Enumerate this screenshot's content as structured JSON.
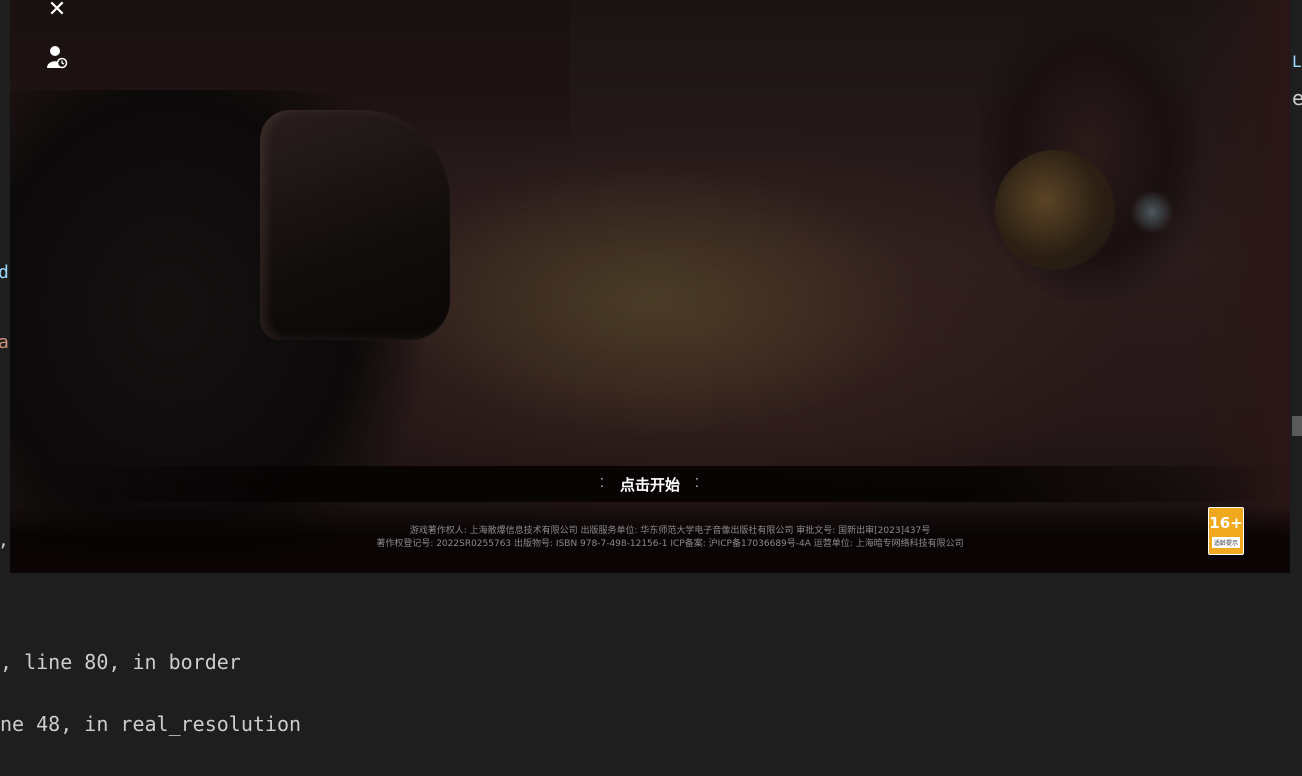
{
  "editor": {
    "background": "#1e1e1e",
    "left_fragments": {
      "frag_di": "di",
      "frag_a": "a",
      "frag_comma": ","
    },
    "right_fragments": {
      "frag_l": "L",
      "frag_e": "e"
    },
    "traceback": {
      "line_1": ", line 80, in border",
      "line_2": "ne 48, in real_resolution"
    }
  },
  "game": {
    "top_icons": [
      "close-tools-icon",
      "user-icon"
    ],
    "start_label": "点击开始",
    "copyright_line_1": "游戏著作权人: 上海散爆信息技术有限公司  出版服务单位: 华东师范大学电子音像出版社有限公司  审批文号: 国新出审[2023]437号",
    "copyright_line_2": "著作权登记号: 2022SR0255763 出版物号: ISBN 978-7-498-12156-1 ICP备案: 沪ICP备17036689号-4A  运营单位: 上海暗专网络科技有限公司",
    "age_rating": {
      "number": "16+",
      "label": "适龄提示",
      "color": "#f0a91e"
    }
  }
}
